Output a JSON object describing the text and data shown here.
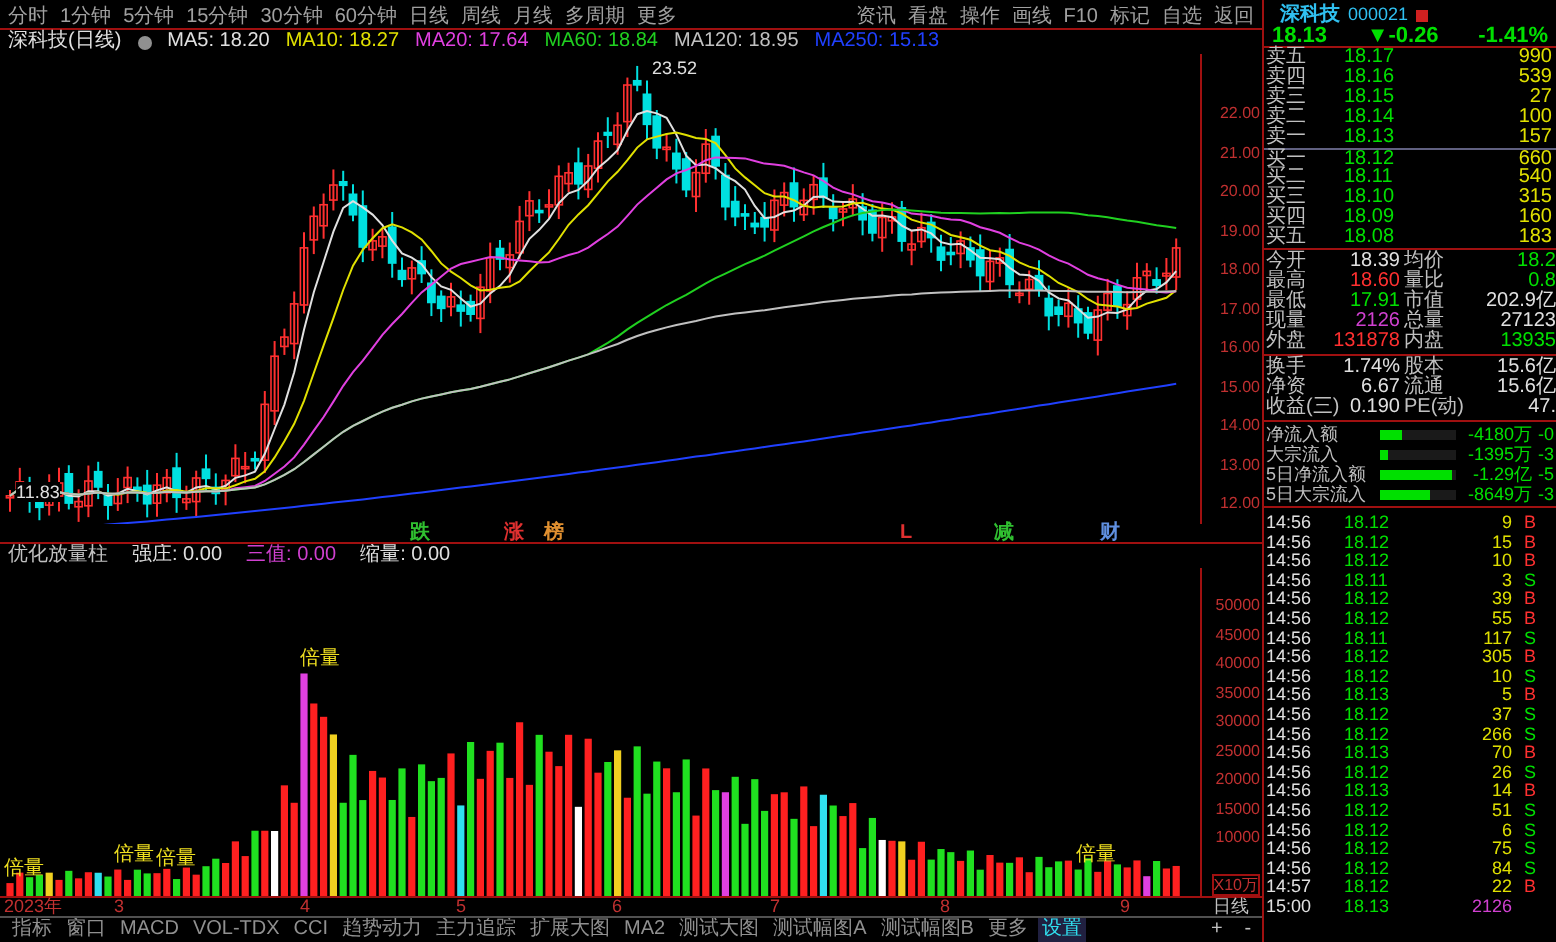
{
  "top_menu": {
    "left_items": [
      "分时",
      "1分钟",
      "5分钟",
      "15分钟",
      "30分钟",
      "60分钟",
      "日线",
      "周线",
      "月线",
      "多周期",
      "更多"
    ],
    "right_items": [
      "资讯",
      "看盘",
      "操作",
      "画线",
      "F10",
      "标记",
      "自选",
      "返回"
    ]
  },
  "chart_legend": {
    "title": "深科技(日线)",
    "averages": [
      {
        "label": "MA5: 18.20",
        "color": "#e0e0e0"
      },
      {
        "label": "MA10: 18.27",
        "color": "#e0e000"
      },
      {
        "label": "MA20: 17.64",
        "color": "#e040e0"
      },
      {
        "label": "MA60: 18.84",
        "color": "#20d020"
      },
      {
        "label": "MA120: 18.95",
        "color": "#c0c0c0"
      },
      {
        "label": "MA250: 15.13",
        "color": "#2040ff"
      }
    ]
  },
  "price_axis": [
    "22.00",
    "21.00",
    "20.00",
    "19.00",
    "18.00",
    "17.00",
    "16.00",
    "15.00",
    "14.00",
    "13.00",
    "12.00"
  ],
  "price_marks": {
    "high": "23.52",
    "low": "11.83"
  },
  "event_marks": [
    {
      "label": "跌",
      "color": "#30c030"
    },
    {
      "label": "涨",
      "color": "#e03030"
    },
    {
      "label": "榜",
      "color": "#e09030"
    },
    {
      "label": "L",
      "color": "#e03030"
    },
    {
      "label": "减",
      "color": "#30c030"
    },
    {
      "label": "财",
      "color": "#6090e0"
    }
  ],
  "volume_legend": {
    "title": "优化放量柱",
    "items": [
      {
        "label": "强庄: 0.00",
        "color": "#e0e0e0"
      },
      {
        "label": "三值: 0.00",
        "color": "#d040d0"
      },
      {
        "label": "缩量: 0.00",
        "color": "#e0e0e0"
      }
    ]
  },
  "volume_axis": [
    "50000",
    "45000",
    "40000",
    "35000",
    "30000",
    "25000",
    "20000",
    "15000",
    "10000"
  ],
  "volume_unit": "X10万",
  "volume_tags": [
    "倍量",
    "倍量",
    "倍量",
    "倍量",
    "倍量"
  ],
  "date_axis": [
    "2023年",
    "3",
    "4",
    "5",
    "6",
    "7",
    "8",
    "9"
  ],
  "period_label": "日线",
  "zoom_controls": [
    "+",
    "-"
  ],
  "bottom_tabs": [
    {
      "label": "指标",
      "selected": false
    },
    {
      "label": "窗口",
      "selected": false
    },
    {
      "label": "MACD",
      "selected": false
    },
    {
      "label": "VOL-TDX",
      "selected": false
    },
    {
      "label": "CCI",
      "selected": false
    },
    {
      "label": "趋势动力",
      "selected": false
    },
    {
      "label": "主力追踪",
      "selected": false
    },
    {
      "label": "扩展大图",
      "selected": false
    },
    {
      "label": "MA2",
      "selected": false
    },
    {
      "label": "测试大图",
      "selected": false
    },
    {
      "label": "测试幅图A",
      "selected": false
    },
    {
      "label": "测试幅图B",
      "selected": false
    },
    {
      "label": "更多",
      "selected": false
    },
    {
      "label": "设置",
      "selected": true
    }
  ],
  "quote": {
    "name": "深科技",
    "code": "000021",
    "price": "18.13",
    "change": "▼-0.26",
    "percent": "-1.41%"
  },
  "order_book": [
    {
      "label": "卖五",
      "price": "18.17",
      "volume": "990"
    },
    {
      "label": "卖四",
      "price": "18.16",
      "volume": "539"
    },
    {
      "label": "卖三",
      "price": "18.15",
      "volume": "27"
    },
    {
      "label": "卖二",
      "price": "18.14",
      "volume": "100"
    },
    {
      "label": "卖一",
      "price": "18.13",
      "volume": "157"
    },
    {
      "label": "买一",
      "price": "18.12",
      "volume": "660"
    },
    {
      "label": "买二",
      "price": "18.11",
      "volume": "540"
    },
    {
      "label": "买三",
      "price": "18.10",
      "volume": "315"
    },
    {
      "label": "买四",
      "price": "18.09",
      "volume": "160"
    },
    {
      "label": "买五",
      "price": "18.08",
      "volume": "183"
    }
  ],
  "stats": [
    {
      "label": "今开",
      "value": "18.39",
      "color": "#e0e0e0"
    },
    {
      "label": "均价",
      "value": "18.2",
      "color": "#00e000"
    },
    {
      "label": "最高",
      "value": "18.60",
      "color": "#ff3030"
    },
    {
      "label": "量比",
      "value": "0.8",
      "color": "#00e000"
    },
    {
      "label": "最低",
      "value": "17.91",
      "color": "#00e000"
    },
    {
      "label": "市值",
      "value": "202.9亿",
      "color": "#e0e0e0"
    },
    {
      "label": "现量",
      "value": "2126",
      "color": "#d040d0"
    },
    {
      "label": "总量",
      "value": "27123",
      "color": "#e0e0e0"
    },
    {
      "label": "外盘",
      "value": "131878",
      "color": "#ff3030"
    },
    {
      "label": "内盘",
      "value": "13935",
      "color": "#00e000"
    }
  ],
  "fundamentals": [
    {
      "label": "换手",
      "value": "1.74%",
      "label2": "股本",
      "value2": "15.6亿"
    },
    {
      "label": "净资",
      "value": "6.67",
      "label2": "流通",
      "value2": "15.6亿"
    },
    {
      "label": "收益(三)",
      "value": "0.190",
      "label2": "PE(动)",
      "value2": "47."
    }
  ],
  "flows": [
    {
      "label": "净流入额",
      "level": 0.3,
      "amount": "-4180万",
      "extra": "-0"
    },
    {
      "label": "大宗流入",
      "level": 0.1,
      "amount": "-1395万",
      "extra": "-3"
    },
    {
      "label": "5日净流入额",
      "level": 0.95,
      "amount": "-1.29亿",
      "extra": "-5"
    },
    {
      "label": "5日大宗流入",
      "level": 0.65,
      "amount": "-8649万",
      "extra": "-3"
    }
  ],
  "trades": [
    {
      "time": "14:56",
      "price": "18.12",
      "volume": "9",
      "side": "B"
    },
    {
      "time": "14:56",
      "price": "18.12",
      "volume": "15",
      "side": "B"
    },
    {
      "time": "14:56",
      "price": "18.12",
      "volume": "10",
      "side": "B"
    },
    {
      "time": "14:56",
      "price": "18.11",
      "volume": "3",
      "side": "S"
    },
    {
      "time": "14:56",
      "price": "18.12",
      "volume": "39",
      "side": "B"
    },
    {
      "time": "14:56",
      "price": "18.12",
      "volume": "55",
      "side": "B"
    },
    {
      "time": "14:56",
      "price": "18.11",
      "volume": "117",
      "side": "S"
    },
    {
      "time": "14:56",
      "price": "18.12",
      "volume": "305",
      "side": "B"
    },
    {
      "time": "14:56",
      "price": "18.12",
      "volume": "10",
      "side": "S"
    },
    {
      "time": "14:56",
      "price": "18.13",
      "volume": "5",
      "side": "B"
    },
    {
      "time": "14:56",
      "price": "18.12",
      "volume": "37",
      "side": "S"
    },
    {
      "time": "14:56",
      "price": "18.12",
      "volume": "266",
      "side": "S"
    },
    {
      "time": "14:56",
      "price": "18.13",
      "volume": "70",
      "side": "B"
    },
    {
      "time": "14:56",
      "price": "18.12",
      "volume": "26",
      "side": "S"
    },
    {
      "time": "14:56",
      "price": "18.13",
      "volume": "14",
      "side": "B"
    },
    {
      "time": "14:56",
      "price": "18.12",
      "volume": "51",
      "side": "S"
    },
    {
      "time": "14:56",
      "price": "18.12",
      "volume": "6",
      "side": "S"
    },
    {
      "time": "14:56",
      "price": "18.12",
      "volume": "75",
      "side": "S"
    },
    {
      "time": "14:56",
      "price": "18.12",
      "volume": "84",
      "side": "S"
    },
    {
      "time": "14:57",
      "price": "18.12",
      "volume": "22",
      "side": "B"
    },
    {
      "time": "15:00",
      "price": "18.13",
      "volume": "2126"
    }
  ]
}
